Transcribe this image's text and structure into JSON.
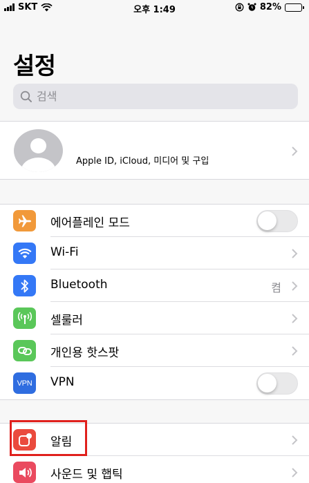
{
  "status": {
    "carrier": "SKT",
    "time": "오후 1:49",
    "battery": "82%",
    "battery_level": 0.82
  },
  "page_title": "설정",
  "search": {
    "placeholder": "검색"
  },
  "profile": {
    "label": "Apple ID, iCloud, 미디어 및 구입"
  },
  "connectivity": [
    {
      "id": "airplane",
      "label": "에어플레인 모드",
      "icon": "airplane-icon",
      "color": "#f1993a",
      "control": "toggle",
      "on": false
    },
    {
      "id": "wifi",
      "label": "Wi-Fi",
      "icon": "wifi-icon",
      "color": "#3478f6",
      "control": "chevron"
    },
    {
      "id": "bluetooth",
      "label": "Bluetooth",
      "icon": "bluetooth-icon",
      "color": "#3478f6",
      "control": "chevron",
      "value": "켬"
    },
    {
      "id": "cellular",
      "label": "셀룰러",
      "icon": "cellular-antenna-icon",
      "color": "#5ac759",
      "control": "chevron"
    },
    {
      "id": "hotspot",
      "label": "개인용 핫스팟",
      "icon": "hotspot-link-icon",
      "color": "#5ac759",
      "control": "chevron"
    },
    {
      "id": "vpn",
      "label": "VPN",
      "icon": "vpn-icon",
      "icon_text": "VPN",
      "color": "#2f6de0",
      "control": "toggle",
      "on": false
    }
  ],
  "notifications": [
    {
      "id": "notifications",
      "label": "알림",
      "icon": "notifications-icon",
      "color": "#ea4a3d",
      "control": "chevron"
    },
    {
      "id": "sounds",
      "label": "사운드 및 햅틱",
      "icon": "speaker-icon",
      "color": "#ea4a5f",
      "control": "chevron"
    }
  ],
  "colors": {
    "highlight": "#e0201c",
    "background": "#efeff4"
  }
}
